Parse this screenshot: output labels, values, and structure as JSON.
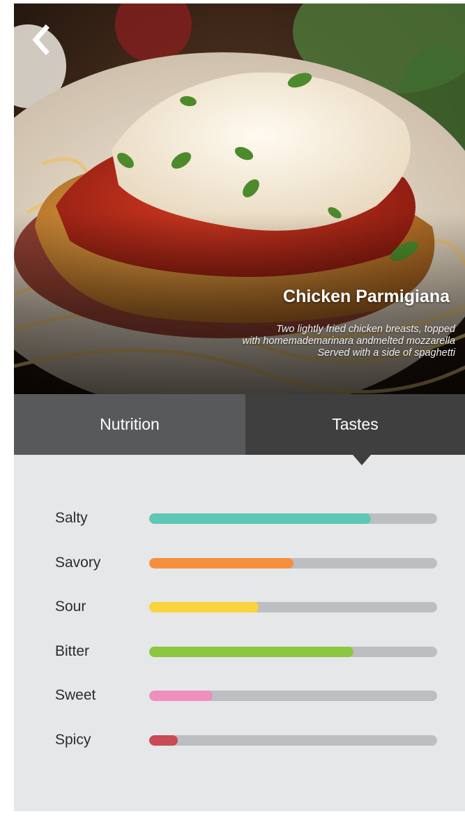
{
  "header": {
    "back_icon": "chevron-left-icon",
    "title": "Chicken Parmigiana",
    "description_lines": [
      "Two lightly fried chicken breasts, topped",
      "with homemademarinara andmelted mozzarella",
      "Served with a side of spaghetti"
    ]
  },
  "tabs": [
    {
      "label": "Nutrition",
      "active": false
    },
    {
      "label": "Tastes",
      "active": true
    }
  ],
  "tastes": [
    {
      "label": "Salty",
      "level": 0.77,
      "color": "#5ec7b6"
    },
    {
      "label": "Savory",
      "level": 0.5,
      "color": "#f68f3c"
    },
    {
      "label": "Sour",
      "level": 0.38,
      "color": "#fbd33b"
    },
    {
      "label": "Bitter",
      "level": 0.71,
      "color": "#8dc63f"
    },
    {
      "label": "Sweet",
      "level": 0.22,
      "color": "#ee8fbe"
    },
    {
      "label": "Spicy",
      "level": 0.1,
      "color": "#c84b55"
    }
  ]
}
